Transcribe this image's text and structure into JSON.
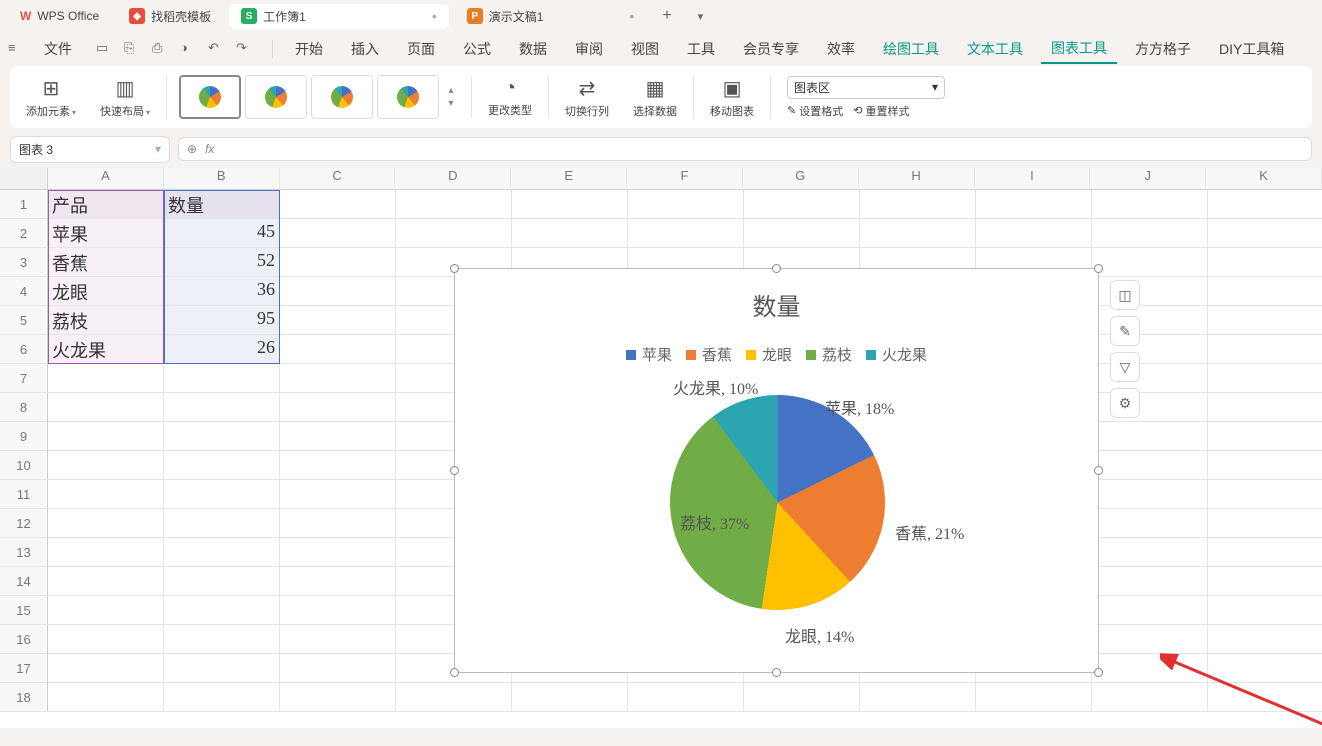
{
  "titlebar": {
    "app": "WPS Office",
    "tabs": [
      {
        "label": "找稻壳模板",
        "icon": "red",
        "active": false
      },
      {
        "label": "工作簿1",
        "icon": "green",
        "active": true,
        "dirty": true
      },
      {
        "label": "演示文稿1",
        "icon": "orange",
        "active": false,
        "dirty": true
      }
    ]
  },
  "menubar": {
    "file": "文件",
    "items": [
      "开始",
      "插入",
      "页面",
      "公式",
      "数据",
      "审阅",
      "视图",
      "工具",
      "会员专享",
      "效率",
      "绘图工具",
      "文本工具",
      "图表工具",
      "方方格子",
      "DIY工具箱"
    ],
    "active": "图表工具",
    "greens": [
      "绘图工具",
      "文本工具",
      "图表工具"
    ]
  },
  "ribbon": {
    "add_element": "添加元素",
    "quick_layout": "快速布局",
    "change_type": "更改类型",
    "switch_rowcol": "切换行列",
    "select_data": "选择数据",
    "move_chart": "移动图表",
    "area_select": "图表区",
    "set_format": "设置格式",
    "reset_style": "重置样式"
  },
  "namebox": "图表 3",
  "fx_label": "fx",
  "columns": [
    "A",
    "B",
    "C",
    "D",
    "E",
    "F",
    "G",
    "H",
    "I",
    "J",
    "K"
  ],
  "rows": [
    "1",
    "2",
    "3",
    "4",
    "5",
    "6",
    "7",
    "8",
    "9",
    "10",
    "11",
    "12",
    "13",
    "14",
    "15",
    "16",
    "17",
    "18"
  ],
  "sheet": {
    "header": {
      "product": "产品",
      "qty": "数量"
    },
    "data": [
      {
        "product": "苹果",
        "qty": 45
      },
      {
        "product": "香蕉",
        "qty": 52
      },
      {
        "product": "龙眼",
        "qty": 36
      },
      {
        "product": "荔枝",
        "qty": 95
      },
      {
        "product": "火龙果",
        "qty": 26
      }
    ]
  },
  "chart_data": {
    "type": "pie",
    "title": "数量",
    "categories": [
      "苹果",
      "香蕉",
      "龙眼",
      "荔枝",
      "火龙果"
    ],
    "values": [
      45,
      52,
      36,
      95,
      26
    ],
    "percent_labels": [
      "苹果, 18%",
      "香蕉, 21%",
      "龙眼, 14%",
      "荔枝, 37%",
      "火龙果, 10%"
    ],
    "colors": [
      "#4472c4",
      "#ed7d31",
      "#ffc000",
      "#70ad47",
      "#2ca5b0"
    ]
  }
}
